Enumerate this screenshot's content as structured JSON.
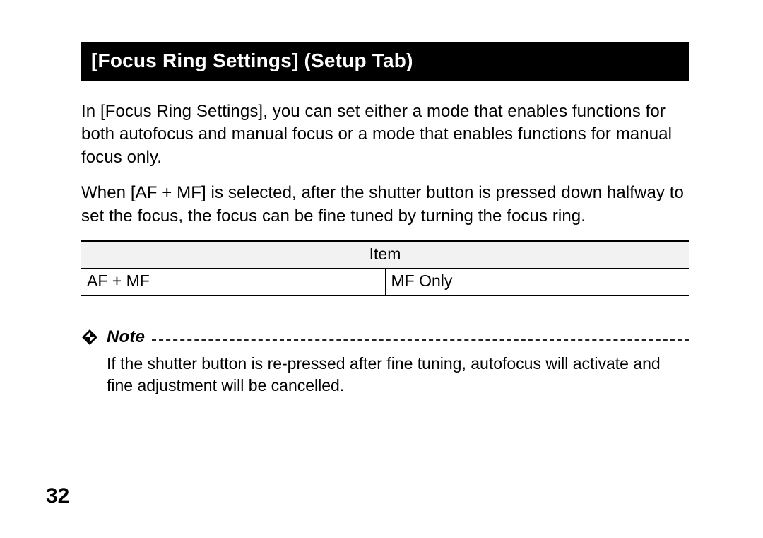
{
  "heading": "[Focus Ring Settings] (Setup Tab)",
  "paragraphs": {
    "p1": "In [Focus Ring Settings], you can set either a mode that enables functions for both autofocus and manual focus or a mode that enables functions for manual focus only.",
    "p2": "When [AF + MF] is selected, after the shutter button is pressed down halfway to set the focus, the focus can be fine tuned by turning the focus ring."
  },
  "table": {
    "header": "Item",
    "cells": [
      "AF + MF",
      "MF Only"
    ]
  },
  "note": {
    "label": "Note",
    "text": "If the shutter button is re-pressed after fine tuning, autofocus will activate and fine adjustment will be cancelled."
  },
  "pageNumber": "32"
}
